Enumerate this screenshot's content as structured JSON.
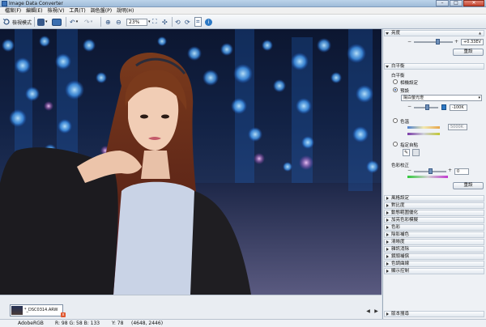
{
  "window": {
    "title": "Image Data Converter"
  },
  "menu": [
    "檔案(F)",
    "編輯(E)",
    "檢視(V)",
    "工具(T)",
    "調色盤(P)",
    "說明(H)"
  ],
  "toolbar": {
    "view_mode_label": "檢視模式",
    "zoom_value": "23%"
  },
  "filmstrip": {
    "file_label": "*_DSC0314.ARW",
    "close_label": "x",
    "prev_label": "◀",
    "next_label": "▶"
  },
  "status": {
    "colorspace": "AdobeRGB",
    "rgb": "R:  98  G:  58  B: 133",
    "ycoord": "Y:  78",
    "coords": "(4648, 2446)"
  },
  "panel": {
    "brightness": {
      "header": "亮度",
      "minus": "−",
      "plus": "+",
      "value": "+0.33EV",
      "button": "重設",
      "level": 0.62
    },
    "white_balance": {
      "header": "白平衡",
      "group_label": "白平衡",
      "option_shot": "相機設定",
      "option_preset": "預設",
      "preset_value": "陽白螢光燈",
      "temp_value": "-100K",
      "temp_level": 0.55,
      "option_temp": "色溫",
      "kelvin_value": "5000K",
      "option_custom": "指定自點",
      "tint_label": "色彩校正",
      "tint_value": "0",
      "tint_level": 0.5,
      "button": "重設"
    },
    "collapsed": [
      "風格設定",
      "對比度",
      "動態範圍優化",
      "加亮色彩模擬",
      "色彩",
      "陰影補色",
      "清晰度",
      "雜訊消除",
      "鏡頭補償",
      "色調曲線",
      "顯示控制"
    ],
    "footer": "版本搜尋"
  },
  "colors": {
    "accent": "#2c78c4",
    "close_button": "#c5432d"
  }
}
